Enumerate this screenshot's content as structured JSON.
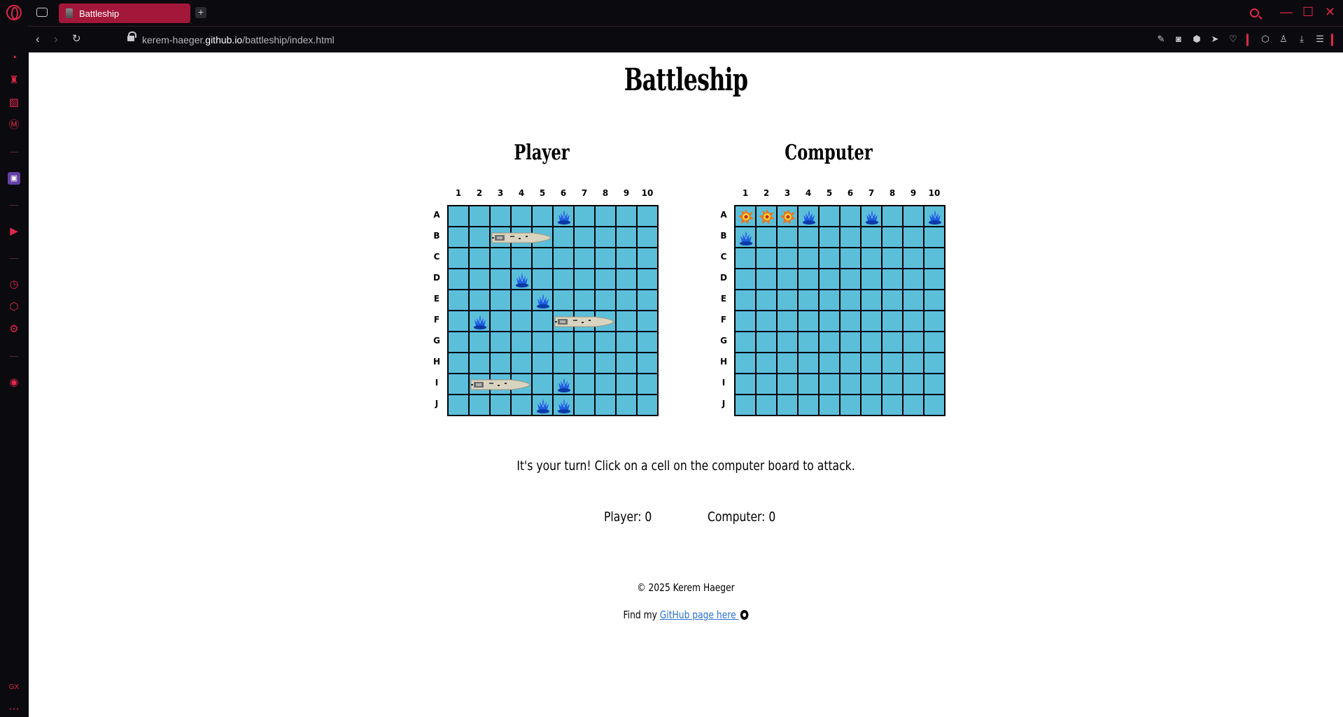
{
  "browser": {
    "tab_title": "Battleship",
    "new_tab": "+",
    "url_prefix": "kerem-haeger.",
    "url_domain": "github.io",
    "url_path": "/battleship/index.html",
    "accent": "#e0274a"
  },
  "page": {
    "title": "Battleship",
    "player_title": "Player",
    "computer_title": "Computer",
    "status": "It's your turn! Click on a cell on the computer board to attack.",
    "player_score": "Player: 0",
    "computer_score": "Computer: 0",
    "copyright": "© 2025 Kerem Haeger",
    "find_prefix": "Find my ",
    "github_link": "GitHub page here "
  },
  "columns": [
    "1",
    "2",
    "3",
    "4",
    "5",
    "6",
    "7",
    "8",
    "9",
    "10"
  ],
  "rows": [
    "A",
    "B",
    "C",
    "D",
    "E",
    "F",
    "G",
    "H",
    "I",
    "J"
  ],
  "player_board": {
    "misses": [
      "A6",
      "D4",
      "E5",
      "F2",
      "I6",
      "J5",
      "J6"
    ],
    "ships": [
      {
        "start": "B3",
        "length": 3
      },
      {
        "start": "F6",
        "length": 3
      },
      {
        "start": "I2",
        "length": 3
      }
    ]
  },
  "computer_board": {
    "hits": [
      "A1",
      "A2",
      "A3"
    ],
    "misses": [
      "A4",
      "A7",
      "A10",
      "B1"
    ]
  },
  "colors": {
    "water": "#5cbfda",
    "splash": "#1f5fe0",
    "hit": "#e8761c"
  }
}
